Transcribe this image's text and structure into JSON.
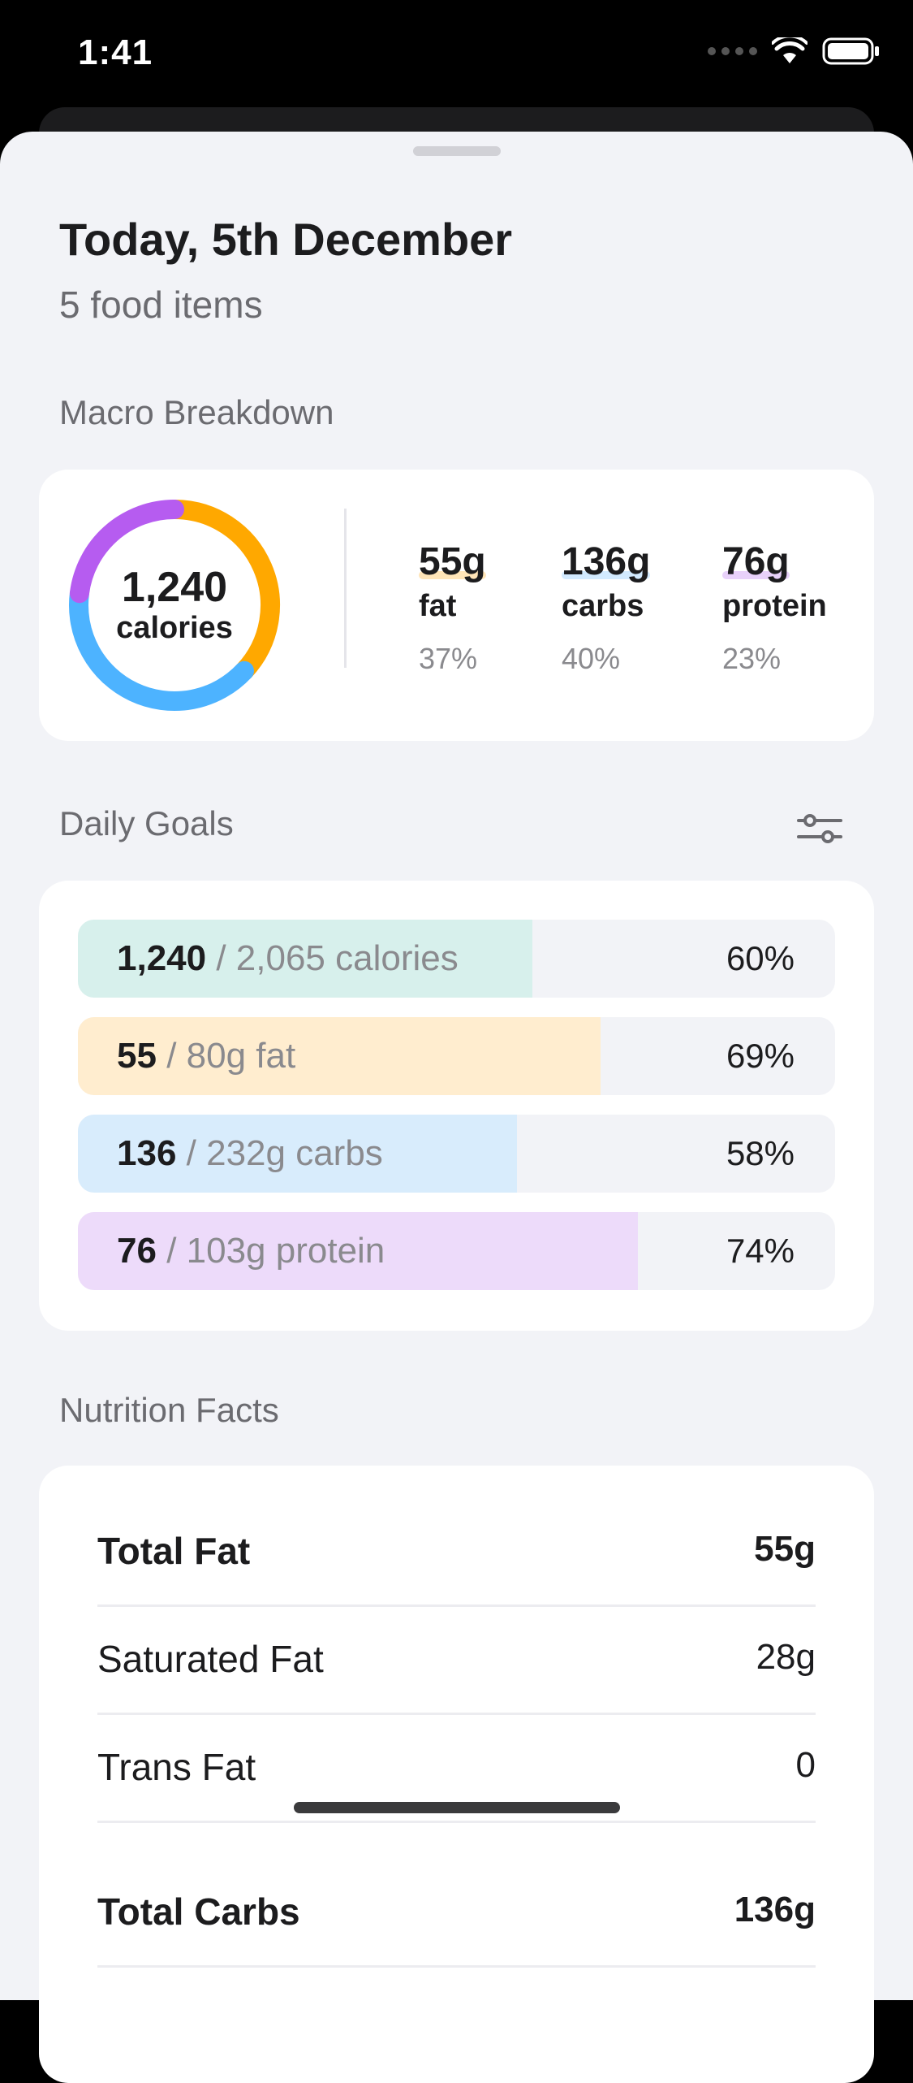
{
  "status_bar": {
    "time": "1:41"
  },
  "header": {
    "title": "Today, 5th December",
    "subtitle": "5 food items"
  },
  "macro_breakdown": {
    "section_title": "Macro Breakdown",
    "total_value": "1,240",
    "total_unit": "calories",
    "donut_fractions": {
      "fat": 0.37,
      "carbs": 0.4,
      "protein": 0.23
    },
    "macros": [
      {
        "amount": "55g",
        "name": "fat",
        "percent": "37%",
        "color": "#FFA800"
      },
      {
        "amount": "136g",
        "name": "carbs",
        "percent": "40%",
        "color": "#4DB3FF"
      },
      {
        "amount": "76g",
        "name": "protein",
        "percent": "23%",
        "color": "#B65CF0"
      }
    ]
  },
  "daily_goals": {
    "section_title": "Daily Goals",
    "filter_icon": "sliders-icon",
    "rows": [
      {
        "current": "1,240",
        "target": "/ 2,065 calories",
        "percent": "60%",
        "fill": 0.6,
        "color": "#D7F0EC"
      },
      {
        "current": "55",
        "target": "/ 80g fat",
        "percent": "69%",
        "fill": 0.69,
        "color": "#FFEDCF"
      },
      {
        "current": "136",
        "target": "/ 232g carbs",
        "percent": "58%",
        "fill": 0.58,
        "color": "#D8ECFC"
      },
      {
        "current": "76",
        "target": "/ 103g protein",
        "percent": "74%",
        "fill": 0.74,
        "color": "#EDDBFA"
      }
    ]
  },
  "nutrition_facts": {
    "section_title": "Nutrition Facts",
    "rows": [
      {
        "label": "Total Fat",
        "value": "55g",
        "bold": true
      },
      {
        "label": "Saturated Fat",
        "value": "28g",
        "bold": false
      },
      {
        "label": "Trans Fat",
        "value": "0",
        "bold": false
      },
      {
        "label": "Total Carbs",
        "value": "136g",
        "bold": true
      }
    ]
  }
}
